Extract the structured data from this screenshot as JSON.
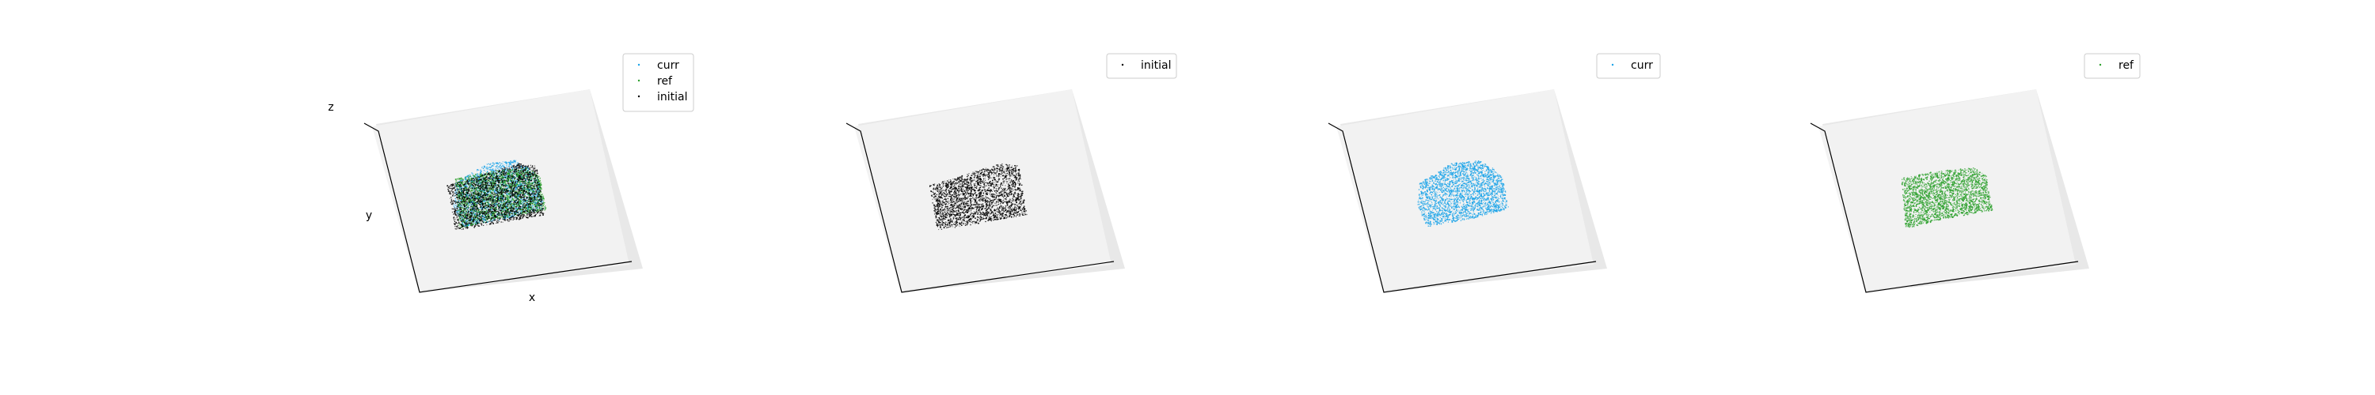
{
  "colors": {
    "background": "#ffffff",
    "pane": "#f2f2f2",
    "pane_side": "#e8e8e8",
    "axis_line": "#000000",
    "legend_border": "#cccccc"
  },
  "chart_data": [
    {
      "type": "scatter3d",
      "xlabel": "x",
      "ylabel": "y",
      "zlabel": "z",
      "grid": false,
      "legend_placement": "top-right",
      "series": [
        {
          "name": "curr",
          "color": "#1aa3e8",
          "shape": "rounded-slab",
          "points": 2200
        },
        {
          "name": "ref",
          "color": "#2ca02c",
          "shape": "slab",
          "points": 2200
        },
        {
          "name": "initial",
          "color": "#000000",
          "shape": "block",
          "points": 2200
        }
      ]
    },
    {
      "type": "scatter3d",
      "xlabel": "",
      "ylabel": "",
      "zlabel": "",
      "grid": false,
      "legend_placement": "top-right",
      "series": [
        {
          "name": "initial",
          "color": "#000000",
          "shape": "block",
          "points": 2600
        }
      ]
    },
    {
      "type": "scatter3d",
      "xlabel": "",
      "ylabel": "",
      "zlabel": "",
      "grid": false,
      "legend_placement": "top-right",
      "series": [
        {
          "name": "curr",
          "color": "#1aa3e8",
          "shape": "rounded-slab",
          "points": 2600
        }
      ]
    },
    {
      "type": "scatter3d",
      "xlabel": "",
      "ylabel": "",
      "zlabel": "",
      "grid": false,
      "legend_placement": "top-right",
      "series": [
        {
          "name": "ref",
          "color": "#2ca02c",
          "shape": "slab",
          "points": 2600
        }
      ]
    }
  ]
}
